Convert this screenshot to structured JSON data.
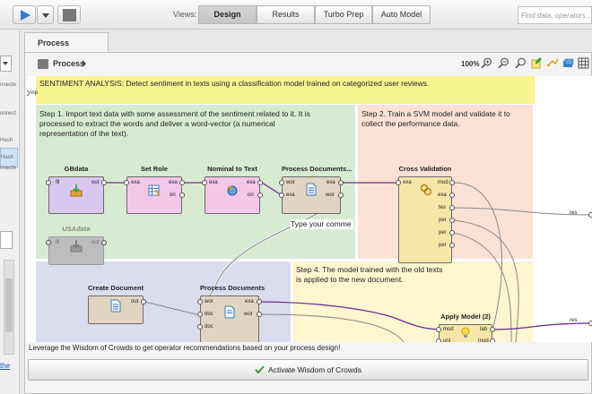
{
  "toolbar": {
    "views_label": "Views:",
    "views": [
      "Design",
      "Results",
      "Turbo Prep",
      "Auto Model"
    ],
    "active_view": "Design",
    "search_placeholder": "Find data, operators...",
    "icons": [
      "play-icon",
      "chevron-down-icon",
      "stop-icon"
    ]
  },
  "left_panel": {
    "fragments": [
      "nnecte",
      "onnect",
      "Hash",
      "Hash",
      "nnecte"
    ],
    "link_text": "the"
  },
  "process": {
    "tab_label": "Process",
    "breadcrumb": "Process",
    "zoom": "100%",
    "toolbar_icons": [
      "zoom-in-icon",
      "zoom-out-icon",
      "zoom-fit-icon",
      "add-note-icon",
      "auto-wire-icon",
      "order-icon",
      "grid-icon"
    ]
  },
  "canvas": {
    "header_note": "SENTIMENT ANALYSIS: Detect sentiment in texts using a classification model trained on categorized user reviews.",
    "step1": "Step 1. Import text data with some assessment of the sentiment related to it. It is processed to extract the words and deliver a word-vector (a numerical representation of the text).",
    "step2": "Step 2. Train a SVM model and validate it to collect the performance data.",
    "step4": "Step 4. The model trained with the old texts is applied to the new document.",
    "comment": "Type your comme",
    "left_port_label": "inp",
    "operators": [
      {
        "id": "gbdata",
        "title": "GBdata",
        "ports_in": [
          "fil"
        ],
        "ports_out": [
          "out"
        ]
      },
      {
        "id": "set-role",
        "title": "Set Role",
        "ports_in": [
          "exa"
        ],
        "ports_out": [
          "exa",
          "ori"
        ]
      },
      {
        "id": "nominal-to-text",
        "title": "Nominal to Text",
        "ports_in": [
          "exa"
        ],
        "ports_out": [
          "exa",
          "ori"
        ]
      },
      {
        "id": "process-documents-1",
        "title": "Process Documents...",
        "ports_in": [
          "wor",
          "exa"
        ],
        "ports_out": [
          "exa",
          "wor"
        ]
      },
      {
        "id": "cross-validation",
        "title": "Cross Validation",
        "ports_in": [
          "exa"
        ],
        "ports_out": [
          "mod",
          "exa",
          "tes",
          "per",
          "per",
          "per"
        ]
      },
      {
        "id": "usadata",
        "title": "USAdata",
        "ports_in": [
          "fil"
        ],
        "ports_out": [
          "out"
        ]
      },
      {
        "id": "create-document",
        "title": "Create Document",
        "ports_in": [],
        "ports_out": [
          "out"
        ]
      },
      {
        "id": "process-documents-2",
        "title": "Process Documents",
        "ports_in": [
          "wor",
          "doc",
          "doc"
        ],
        "ports_out": [
          "exa",
          "wor"
        ]
      },
      {
        "id": "apply-model",
        "title": "Apply Model (2)",
        "ports_in": [
          "mod",
          "unl"
        ],
        "ports_out": [
          "lab",
          "mod"
        ]
      }
    ],
    "result_ports": [
      "res",
      "res"
    ]
  },
  "wisdom": {
    "hint": "Leverage the Wisdom of Crowds to get operator recommendations based on your process design!",
    "button": "Activate Wisdom of Crowds"
  },
  "colors": {
    "note_yellow": "#f7f58f",
    "step1_green": "#d9ead3",
    "step2_peach": "#fbe2d5",
    "step3_lavender": "#dcdcef",
    "step4_cream": "#fdf6d1",
    "op_pink": "#f4c6e8",
    "op_purple": "#d8c7ee",
    "op_tan": "#e0d5c0",
    "op_gold": "#f8e6a8",
    "op_grey": "#bdbdbd"
  }
}
